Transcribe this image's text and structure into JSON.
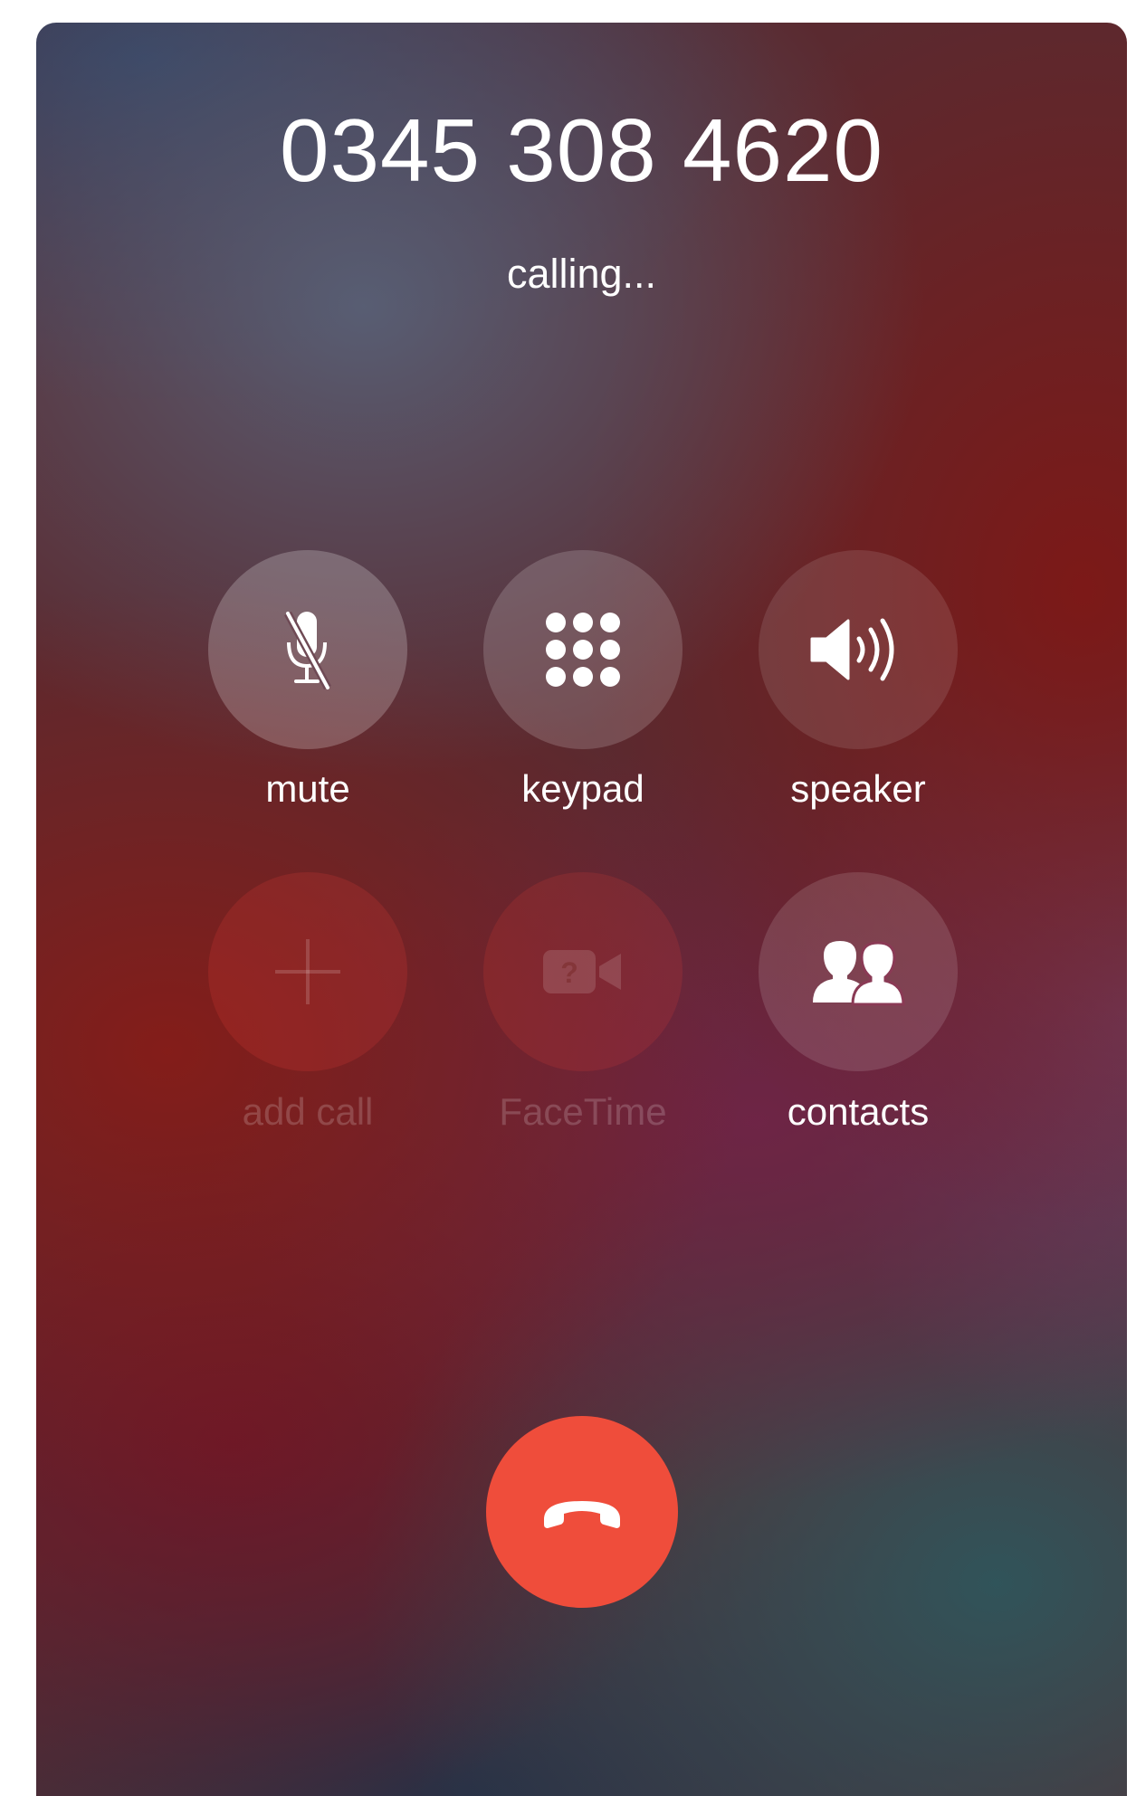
{
  "call": {
    "number": "0345 308 4620",
    "status": "calling..."
  },
  "controls": [
    {
      "label": "mute",
      "icon": "mic-off-icon",
      "enabled": true
    },
    {
      "label": "keypad",
      "icon": "keypad-icon",
      "enabled": true
    },
    {
      "label": "speaker",
      "icon": "speaker-icon",
      "enabled": true
    },
    {
      "label": "add call",
      "icon": "plus-icon",
      "enabled": false
    },
    {
      "label": "FaceTime",
      "icon": "facetime-icon",
      "enabled": false
    },
    {
      "label": "contacts",
      "icon": "contacts-icon",
      "enabled": true
    }
  ],
  "end_call": {
    "icon": "end-call-icon",
    "color": "#EF4D3B"
  }
}
